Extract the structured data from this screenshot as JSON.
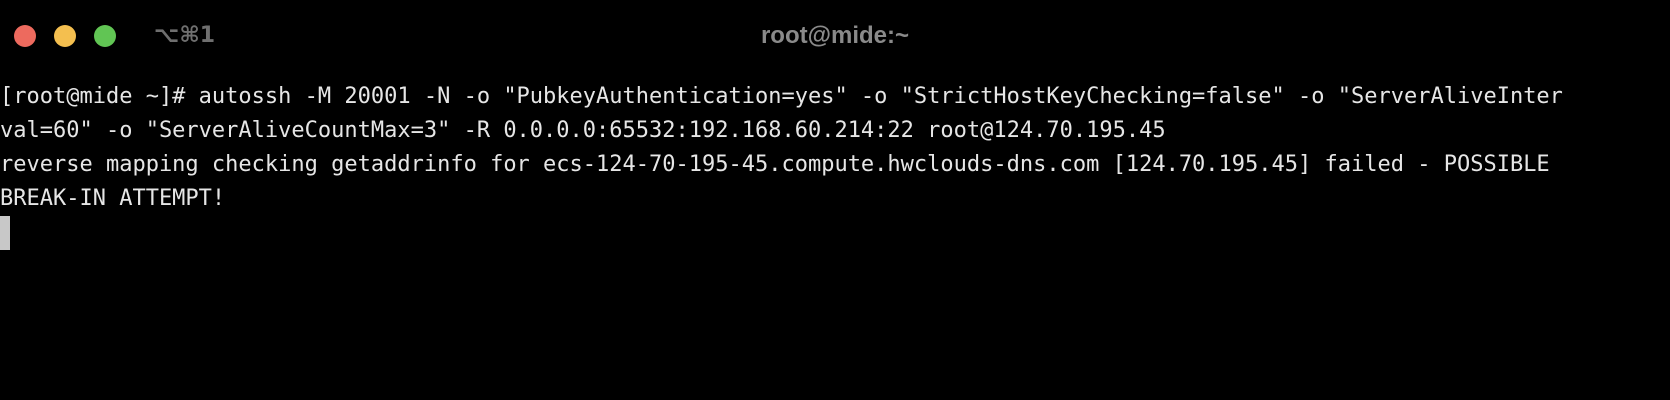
{
  "window": {
    "title": "root@mide:~",
    "shortcut": "⌥⌘1",
    "traffic_lights": {
      "close_color": "#ed6a5e",
      "minimize_color": "#f4bf4f",
      "zoom_color": "#61c554"
    }
  },
  "terminal": {
    "background": "#000000",
    "foreground": "#e6e6e6",
    "lines": [
      "[root@mide ~]# autossh -M 20001 -N -o \"PubkeyAuthentication=yes\" -o \"StrictHostKeyChecking=false\" -o \"ServerAliveInter",
      "val=60\" -o \"ServerAliveCountMax=3\" -R 0.0.0.0:65532:192.168.60.214:22 root@124.70.195.45",
      "reverse mapping checking getaddrinfo for ecs-124-70-195-45.compute.hwclouds-dns.com [124.70.195.45] failed - POSSIBLE",
      "BREAK-IN ATTEMPT!"
    ]
  }
}
